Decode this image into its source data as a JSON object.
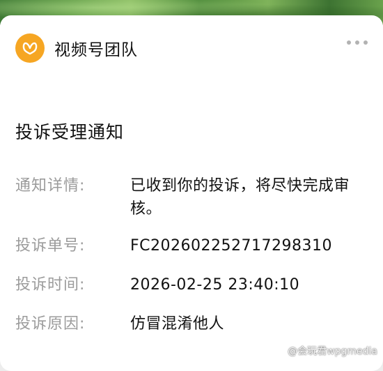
{
  "account": {
    "name": "视频号团队",
    "avatar_icon": "channels-butterfly-icon",
    "avatar_color": "#f6a623"
  },
  "menu": {
    "icon": "more-dots-icon"
  },
  "notice": {
    "title": "投诉受理通知",
    "rows": [
      {
        "label": "通知详情:",
        "value": "已收到你的投诉，将尽快完成审核。"
      },
      {
        "label": "投诉单号:",
        "value": "FC20260225271729831​0"
      },
      {
        "label": "投诉时间:",
        "value": "2026-02-25 23:40:10"
      },
      {
        "label": "投诉原因:",
        "value": "仿冒混淆他人"
      }
    ]
  },
  "watermark": {
    "text": "@会玩君wpgmedia",
    "icon": "weibo-icon"
  }
}
